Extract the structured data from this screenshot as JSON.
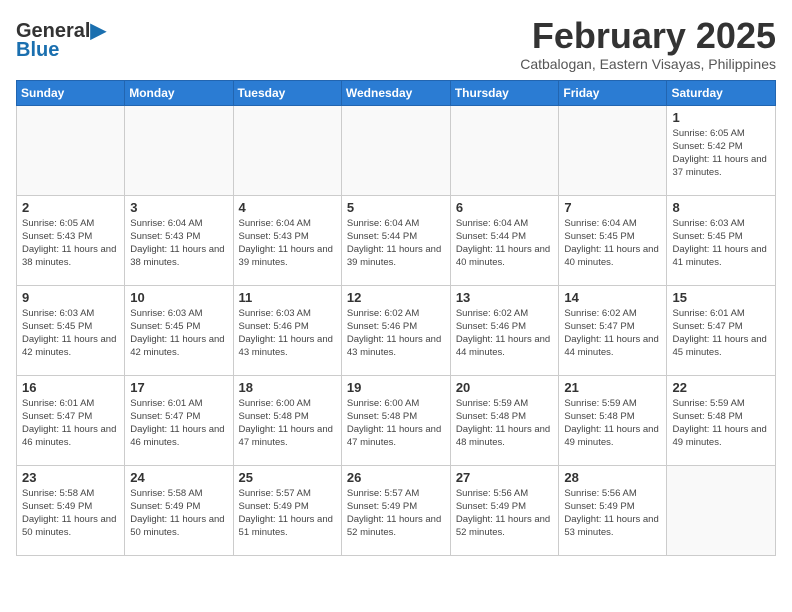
{
  "header": {
    "logo_general": "General",
    "logo_blue": "Blue",
    "month_title": "February 2025",
    "subtitle": "Catbalogan, Eastern Visayas, Philippines"
  },
  "weekdays": [
    "Sunday",
    "Monday",
    "Tuesday",
    "Wednesday",
    "Thursday",
    "Friday",
    "Saturday"
  ],
  "weeks": [
    [
      {
        "day": "",
        "info": ""
      },
      {
        "day": "",
        "info": ""
      },
      {
        "day": "",
        "info": ""
      },
      {
        "day": "",
        "info": ""
      },
      {
        "day": "",
        "info": ""
      },
      {
        "day": "",
        "info": ""
      },
      {
        "day": "1",
        "info": "Sunrise: 6:05 AM\nSunset: 5:42 PM\nDaylight: 11 hours\nand 37 minutes."
      }
    ],
    [
      {
        "day": "2",
        "info": "Sunrise: 6:05 AM\nSunset: 5:43 PM\nDaylight: 11 hours\nand 38 minutes."
      },
      {
        "day": "3",
        "info": "Sunrise: 6:04 AM\nSunset: 5:43 PM\nDaylight: 11 hours\nand 38 minutes."
      },
      {
        "day": "4",
        "info": "Sunrise: 6:04 AM\nSunset: 5:43 PM\nDaylight: 11 hours\nand 39 minutes."
      },
      {
        "day": "5",
        "info": "Sunrise: 6:04 AM\nSunset: 5:44 PM\nDaylight: 11 hours\nand 39 minutes."
      },
      {
        "day": "6",
        "info": "Sunrise: 6:04 AM\nSunset: 5:44 PM\nDaylight: 11 hours\nand 40 minutes."
      },
      {
        "day": "7",
        "info": "Sunrise: 6:04 AM\nSunset: 5:45 PM\nDaylight: 11 hours\nand 40 minutes."
      },
      {
        "day": "8",
        "info": "Sunrise: 6:03 AM\nSunset: 5:45 PM\nDaylight: 11 hours\nand 41 minutes."
      }
    ],
    [
      {
        "day": "9",
        "info": "Sunrise: 6:03 AM\nSunset: 5:45 PM\nDaylight: 11 hours\nand 42 minutes."
      },
      {
        "day": "10",
        "info": "Sunrise: 6:03 AM\nSunset: 5:45 PM\nDaylight: 11 hours\nand 42 minutes."
      },
      {
        "day": "11",
        "info": "Sunrise: 6:03 AM\nSunset: 5:46 PM\nDaylight: 11 hours\nand 43 minutes."
      },
      {
        "day": "12",
        "info": "Sunrise: 6:02 AM\nSunset: 5:46 PM\nDaylight: 11 hours\nand 43 minutes."
      },
      {
        "day": "13",
        "info": "Sunrise: 6:02 AM\nSunset: 5:46 PM\nDaylight: 11 hours\nand 44 minutes."
      },
      {
        "day": "14",
        "info": "Sunrise: 6:02 AM\nSunset: 5:47 PM\nDaylight: 11 hours\nand 44 minutes."
      },
      {
        "day": "15",
        "info": "Sunrise: 6:01 AM\nSunset: 5:47 PM\nDaylight: 11 hours\nand 45 minutes."
      }
    ],
    [
      {
        "day": "16",
        "info": "Sunrise: 6:01 AM\nSunset: 5:47 PM\nDaylight: 11 hours\nand 46 minutes."
      },
      {
        "day": "17",
        "info": "Sunrise: 6:01 AM\nSunset: 5:47 PM\nDaylight: 11 hours\nand 46 minutes."
      },
      {
        "day": "18",
        "info": "Sunrise: 6:00 AM\nSunset: 5:48 PM\nDaylight: 11 hours\nand 47 minutes."
      },
      {
        "day": "19",
        "info": "Sunrise: 6:00 AM\nSunset: 5:48 PM\nDaylight: 11 hours\nand 47 minutes."
      },
      {
        "day": "20",
        "info": "Sunrise: 5:59 AM\nSunset: 5:48 PM\nDaylight: 11 hours\nand 48 minutes."
      },
      {
        "day": "21",
        "info": "Sunrise: 5:59 AM\nSunset: 5:48 PM\nDaylight: 11 hours\nand 49 minutes."
      },
      {
        "day": "22",
        "info": "Sunrise: 5:59 AM\nSunset: 5:48 PM\nDaylight: 11 hours\nand 49 minutes."
      }
    ],
    [
      {
        "day": "23",
        "info": "Sunrise: 5:58 AM\nSunset: 5:49 PM\nDaylight: 11 hours\nand 50 minutes."
      },
      {
        "day": "24",
        "info": "Sunrise: 5:58 AM\nSunset: 5:49 PM\nDaylight: 11 hours\nand 50 minutes."
      },
      {
        "day": "25",
        "info": "Sunrise: 5:57 AM\nSunset: 5:49 PM\nDaylight: 11 hours\nand 51 minutes."
      },
      {
        "day": "26",
        "info": "Sunrise: 5:57 AM\nSunset: 5:49 PM\nDaylight: 11 hours\nand 52 minutes."
      },
      {
        "day": "27",
        "info": "Sunrise: 5:56 AM\nSunset: 5:49 PM\nDaylight: 11 hours\nand 52 minutes."
      },
      {
        "day": "28",
        "info": "Sunrise: 5:56 AM\nSunset: 5:49 PM\nDaylight: 11 hours\nand 53 minutes."
      },
      {
        "day": "",
        "info": ""
      }
    ]
  ]
}
